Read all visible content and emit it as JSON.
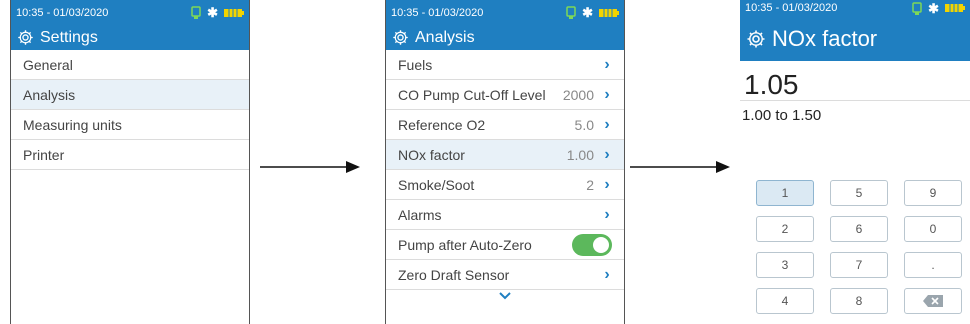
{
  "status": {
    "time": "10:35 - 01/03/2020"
  },
  "colors": {
    "accent": "#1f7fc1",
    "toggle_on": "#5cb85c",
    "selected_row": "#e8f1f8"
  },
  "icons": [
    "gear-icon",
    "probe-icon",
    "bluetooth-icon",
    "battery-icon",
    "chevron-right-icon",
    "chevron-down-icon",
    "backspace-icon",
    "arrow-right-icon"
  ],
  "settings": {
    "title": "Settings",
    "items": [
      {
        "label": "General"
      },
      {
        "label": "Analysis",
        "selected": true
      },
      {
        "label": "Measuring units"
      },
      {
        "label": "Printer"
      }
    ]
  },
  "analysis": {
    "title": "Analysis",
    "items": [
      {
        "label": "Fuels",
        "value": ""
      },
      {
        "label": "CO Pump Cut-Off Level",
        "value": "2000"
      },
      {
        "label": "Reference O2",
        "value": "5.0"
      },
      {
        "label": "NOx factor",
        "value": "1.00",
        "selected": true
      },
      {
        "label": "Smoke/Soot",
        "value": "2"
      },
      {
        "label": "Alarms",
        "value": ""
      },
      {
        "label": "Pump after Auto-Zero",
        "toggle": true
      },
      {
        "label": "Zero Draft Sensor",
        "value": ""
      }
    ],
    "pump_after_autozero_on": true
  },
  "nox": {
    "title": "NOx factor",
    "value": "1.05",
    "range": "1.00 to 1.50",
    "keys": {
      "k1": "1",
      "k2": "2",
      "k3": "3",
      "k4": "4",
      "k5": "5",
      "k6": "6",
      "k7": "7",
      "k8": "8",
      "k9": "9",
      "k0": "0",
      "dot": "."
    }
  }
}
